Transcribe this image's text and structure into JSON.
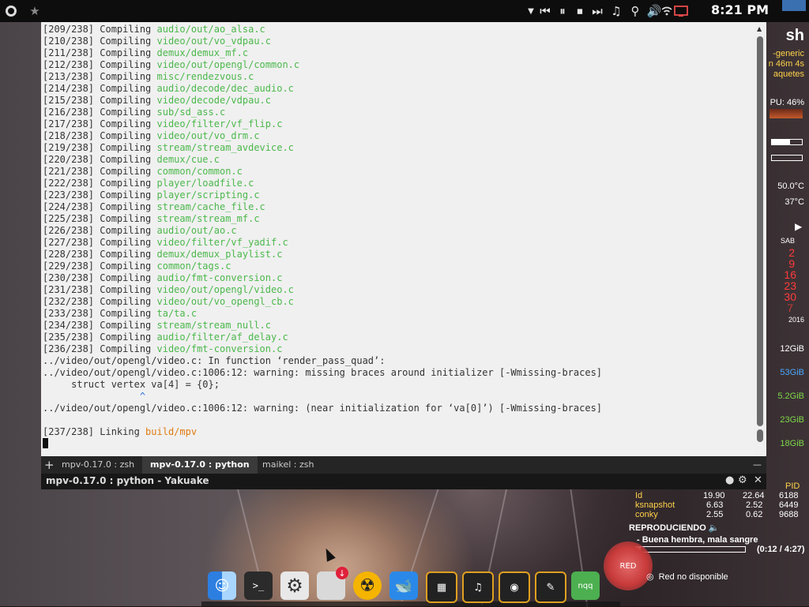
{
  "top_panel": {
    "clock": "8:21 PM",
    "icons": [
      "apps-icon",
      "star-icon",
      "menu-arrow-icon",
      "prev-icon",
      "pause-icon",
      "stop-icon",
      "next-icon",
      "music-icon",
      "network-icon",
      "volume-icon",
      "wifi-icon",
      "screen-icon"
    ]
  },
  "terminal": {
    "lines": [
      {
        "prefix": "[209/238] Compiling ",
        "path": "audio/out/ao_alsa.c"
      },
      {
        "prefix": "[210/238] Compiling ",
        "path": "video/out/vo_vdpau.c"
      },
      {
        "prefix": "[211/238] Compiling ",
        "path": "demux/demux_mf.c"
      },
      {
        "prefix": "[212/238] Compiling ",
        "path": "video/out/opengl/common.c"
      },
      {
        "prefix": "[213/238] Compiling ",
        "path": "misc/rendezvous.c"
      },
      {
        "prefix": "[214/238] Compiling ",
        "path": "audio/decode/dec_audio.c"
      },
      {
        "prefix": "[215/238] Compiling ",
        "path": "video/decode/vdpau.c"
      },
      {
        "prefix": "[216/238] Compiling ",
        "path": "sub/sd_ass.c"
      },
      {
        "prefix": "[217/238] Compiling ",
        "path": "video/filter/vf_flip.c"
      },
      {
        "prefix": "[218/238] Compiling ",
        "path": "video/out/vo_drm.c"
      },
      {
        "prefix": "[219/238] Compiling ",
        "path": "stream/stream_avdevice.c"
      },
      {
        "prefix": "[220/238] Compiling ",
        "path": "demux/cue.c"
      },
      {
        "prefix": "[221/238] Compiling ",
        "path": "common/common.c"
      },
      {
        "prefix": "[222/238] Compiling ",
        "path": "player/loadfile.c"
      },
      {
        "prefix": "[223/238] Compiling ",
        "path": "player/scripting.c"
      },
      {
        "prefix": "[224/238] Compiling ",
        "path": "stream/cache_file.c"
      },
      {
        "prefix": "[225/238] Compiling ",
        "path": "stream/stream_mf.c"
      },
      {
        "prefix": "[226/238] Compiling ",
        "path": "audio/out/ao.c"
      },
      {
        "prefix": "[227/238] Compiling ",
        "path": "video/filter/vf_yadif.c"
      },
      {
        "prefix": "[228/238] Compiling ",
        "path": "demux/demux_playlist.c"
      },
      {
        "prefix": "[229/238] Compiling ",
        "path": "common/tags.c"
      },
      {
        "prefix": "[230/238] Compiling ",
        "path": "audio/fmt-conversion.c"
      },
      {
        "prefix": "[231/238] Compiling ",
        "path": "video/out/opengl/video.c"
      },
      {
        "prefix": "[232/238] Compiling ",
        "path": "video/out/vo_opengl_cb.c"
      },
      {
        "prefix": "[233/238] Compiling ",
        "path": "ta/ta.c"
      },
      {
        "prefix": "[234/238] Compiling ",
        "path": "stream/stream_null.c"
      },
      {
        "prefix": "[235/238] Compiling ",
        "path": "audio/filter/af_delay.c"
      },
      {
        "prefix": "[236/238] Compiling ",
        "path": "video/fmt-conversion.c"
      }
    ],
    "warn1": "../video/out/opengl/video.c: In function ‘render_pass_quad’:",
    "warn2": "../video/out/opengl/video.c:1006:12: warning: missing braces around initializer [-Wmissing-braces]",
    "warn3": "     struct vertex va[4] = {0};",
    "warn4": "                 ^",
    "warn5": "../video/out/opengl/video.c:1006:12: warning: (near initialization for ‘va[0]’) [-Wmissing-braces]",
    "link_prefix": "[237/238] Linking ",
    "link_target": "build/mpv"
  },
  "tabs": [
    {
      "label": "mpv-0.17.0 : zsh",
      "active": false
    },
    {
      "label": "mpv-0.17.0 : python",
      "active": true
    },
    {
      "label": "maikel : zsh",
      "active": false
    }
  ],
  "window_title": "mpv-0.17.0 : python - Yakuake",
  "conky": {
    "shell": "sh",
    "kernel": "-generic",
    "uptime": "n 46m 4s",
    "packages": "aquetes",
    "cpu": "PU: 46%",
    "temp1": "50.0°C",
    "temp2": "37°C",
    "day_header": "SAB",
    "days": [
      "2",
      "9",
      "16",
      "23",
      "30",
      "7"
    ],
    "year": "2016",
    "disk1": "12GiB",
    "disk2": "53GiB",
    "disk3": "5.2GiB",
    "disk4": "23GiB",
    "disk5": "18GiB"
  },
  "processes": {
    "pid_header": "PID",
    "rows": [
      {
        "name": "Id",
        "cpu": "19.90",
        "mem": "22.64",
        "pid": "6188"
      },
      {
        "name": "ksnapshot",
        "cpu": "6.63",
        "mem": "2.52",
        "pid": "6449"
      },
      {
        "name": "conky",
        "cpu": "2.55",
        "mem": "0.62",
        "pid": "9688"
      }
    ]
  },
  "music": {
    "header": "REPRODUCIENDO",
    "track": "- Buena hembra, mala sangre",
    "time": "(0:12 / 4:27)"
  },
  "network": {
    "badge": "RED",
    "status": "Red no disponible"
  },
  "dock": {
    "items": [
      "finder-icon",
      "terminal-icon",
      "settings-icon",
      "downloader-icon",
      "radiation-icon",
      "whale-icon",
      "apps-grid-icon",
      "media-grid-icon",
      "browsers-grid-icon",
      "tools-grid-icon",
      "nqq-icon"
    ],
    "nqq_label": "nqq"
  }
}
